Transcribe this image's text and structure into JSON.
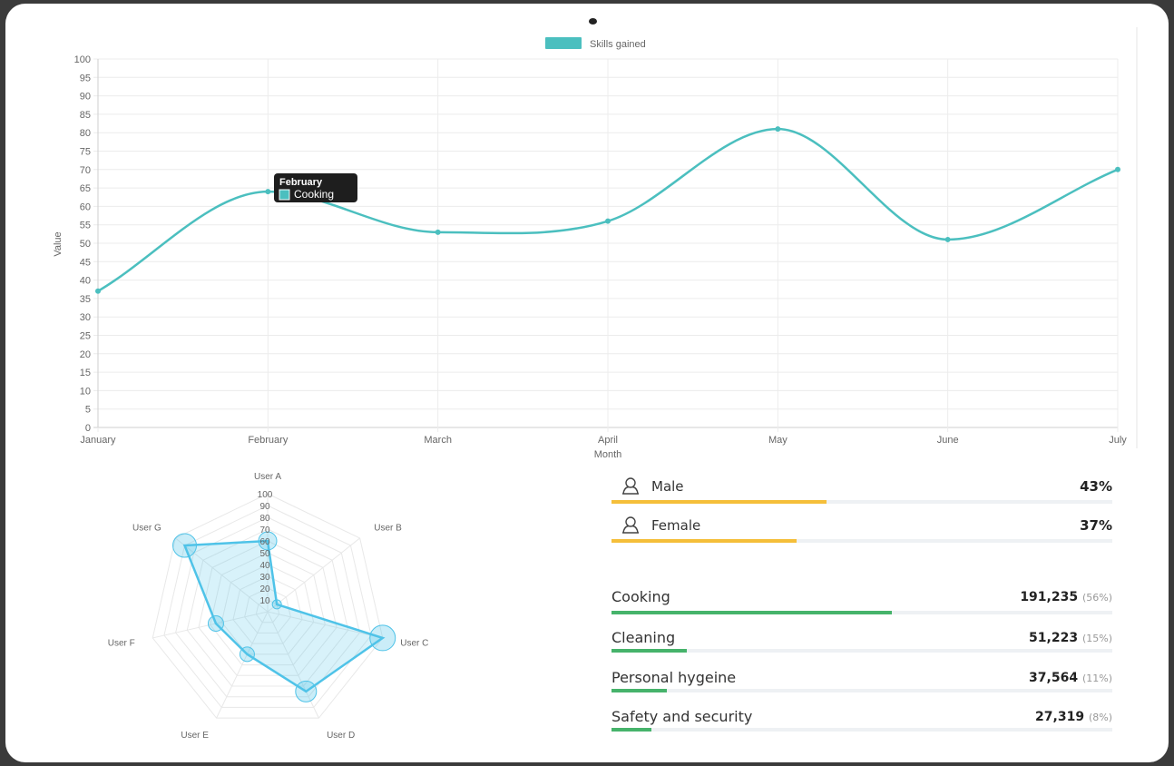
{
  "line_chart": {
    "legend_label": "Skills gained",
    "series_color": "#4bbfbf",
    "tooltip": {
      "title": "February",
      "label": "Cooking"
    }
  },
  "gender": [
    {
      "label": "Male",
      "value": "43%",
      "fraction": 0.43,
      "icon": "person-icon"
    },
    {
      "label": "Female",
      "value": "37%",
      "fraction": 0.37,
      "icon": "person-icon"
    }
  ],
  "gender_bar_color": "#f5bf3a",
  "skills": [
    {
      "label": "Cooking",
      "value": "191,235",
      "pct": "(56%)",
      "fraction": 0.56
    },
    {
      "label": "Cleaning",
      "value": "51,223",
      "pct": "(15%)",
      "fraction": 0.15
    },
    {
      "label": "Personal hygeine",
      "value": "37,564",
      "pct": "(11%)",
      "fraction": 0.11
    },
    {
      "label": "Safety and security",
      "value": "27,319",
      "pct": "(8%)",
      "fraction": 0.08
    }
  ],
  "skills_bar_color": "#46b36b",
  "chart_data": [
    {
      "type": "line",
      "categories": [
        "January",
        "February",
        "March",
        "April",
        "May",
        "June",
        "July"
      ],
      "series": [
        {
          "name": "Skills gained",
          "values": [
            37,
            64,
            53,
            56,
            81,
            51,
            70
          ]
        }
      ],
      "xlabel": "Month",
      "ylabel": "Value",
      "ylim": [
        0,
        100
      ],
      "yticks": [
        0,
        5,
        10,
        15,
        20,
        25,
        30,
        35,
        40,
        45,
        50,
        55,
        60,
        65,
        70,
        75,
        80,
        85,
        90,
        95,
        100
      ],
      "grid": true,
      "legend": "top-center"
    },
    {
      "type": "radar",
      "categories": [
        "User A",
        "User B",
        "User C",
        "User D",
        "User E",
        "User F",
        "User G"
      ],
      "series": [
        {
          "values": [
            60,
            10,
            100,
            75,
            40,
            45,
            90
          ]
        }
      ],
      "rlim": [
        0,
        100
      ],
      "rticks": [
        10,
        20,
        30,
        40,
        50,
        60,
        70,
        80,
        90,
        100
      ],
      "series_color": "#4fc3e8"
    }
  ]
}
